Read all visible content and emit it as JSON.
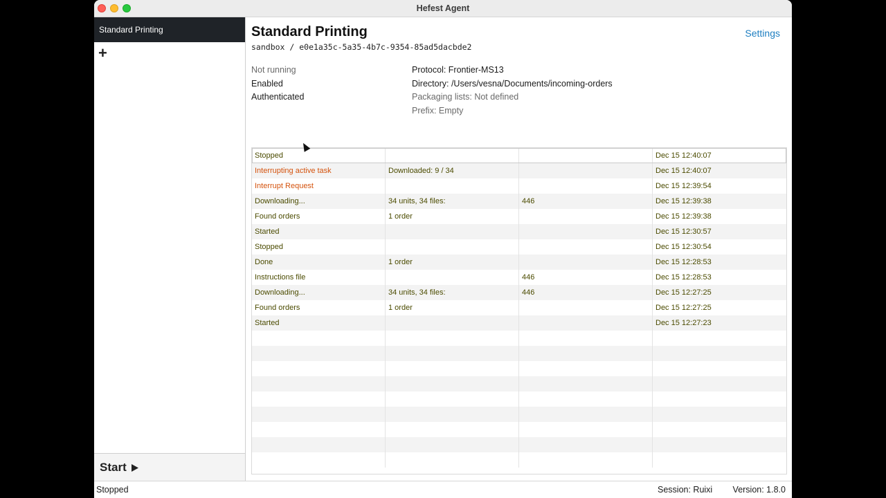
{
  "window": {
    "title": "Hefest Agent"
  },
  "sidebar": {
    "items": [
      {
        "label": "Standard Printing"
      }
    ],
    "add_symbol": "+",
    "start_label": "Start",
    "start_icon": "play-icon"
  },
  "header": {
    "title": "Standard Printing",
    "subtitle": "sandbox / e0e1a35c-5a35-4b7c-9354-85ad5dacbde2",
    "settings_label": "Settings"
  },
  "status_left": [
    {
      "text": "Not running",
      "muted": true
    },
    {
      "text": "Enabled",
      "muted": false
    },
    {
      "text": "Authenticated",
      "muted": false
    }
  ],
  "status_right": [
    {
      "text": "Protocol: Frontier-MS13",
      "muted": false
    },
    {
      "text": "Directory: /Users/vesna/Documents/incoming-orders",
      "muted": false
    },
    {
      "text": "Packaging lists: Not defined",
      "muted": true
    },
    {
      "text": "Prefix: Empty",
      "muted": true
    }
  ],
  "log_rows": [
    {
      "event": "Stopped",
      "detail": "",
      "extra": "",
      "time": "Dec 15 12:40:07",
      "color": "olive"
    },
    {
      "event": "Interrupting active task",
      "detail": "Downloaded: 9 / 34",
      "extra": "",
      "time": "Dec 15 12:40:07",
      "color": "orange"
    },
    {
      "event": "Interrupt Request",
      "detail": "",
      "extra": "",
      "time": "Dec 15 12:39:54",
      "color": "orange"
    },
    {
      "event": "Downloading...",
      "detail": "34 units, 34 files:",
      "extra": "446",
      "time": "Dec 15 12:39:38",
      "color": "olive"
    },
    {
      "event": "Found orders",
      "detail": "1 order",
      "extra": "",
      "time": "Dec 15 12:39:38",
      "color": "olive"
    },
    {
      "event": "Started",
      "detail": "",
      "extra": "",
      "time": "Dec 15 12:30:57",
      "color": "olive"
    },
    {
      "event": "Stopped",
      "detail": "",
      "extra": "",
      "time": "Dec 15 12:30:54",
      "color": "olive"
    },
    {
      "event": "Done",
      "detail": "1 order",
      "extra": "",
      "time": "Dec 15 12:28:53",
      "color": "olive"
    },
    {
      "event": "Instructions file",
      "detail": "",
      "extra": "446",
      "time": "Dec 15 12:28:53",
      "color": "olive"
    },
    {
      "event": "Downloading...",
      "detail": "34 units, 34 files:",
      "extra": "446",
      "time": "Dec 15 12:27:25",
      "color": "olive"
    },
    {
      "event": "Found orders",
      "detail": "1 order",
      "extra": "",
      "time": "Dec 15 12:27:25",
      "color": "olive"
    },
    {
      "event": "Started",
      "detail": "",
      "extra": "",
      "time": "Dec 15 12:27:23",
      "color": "olive"
    }
  ],
  "statusbar": {
    "state": "Stopped",
    "session": "Session: Ruixi",
    "version": "Version: 1.8.0"
  }
}
